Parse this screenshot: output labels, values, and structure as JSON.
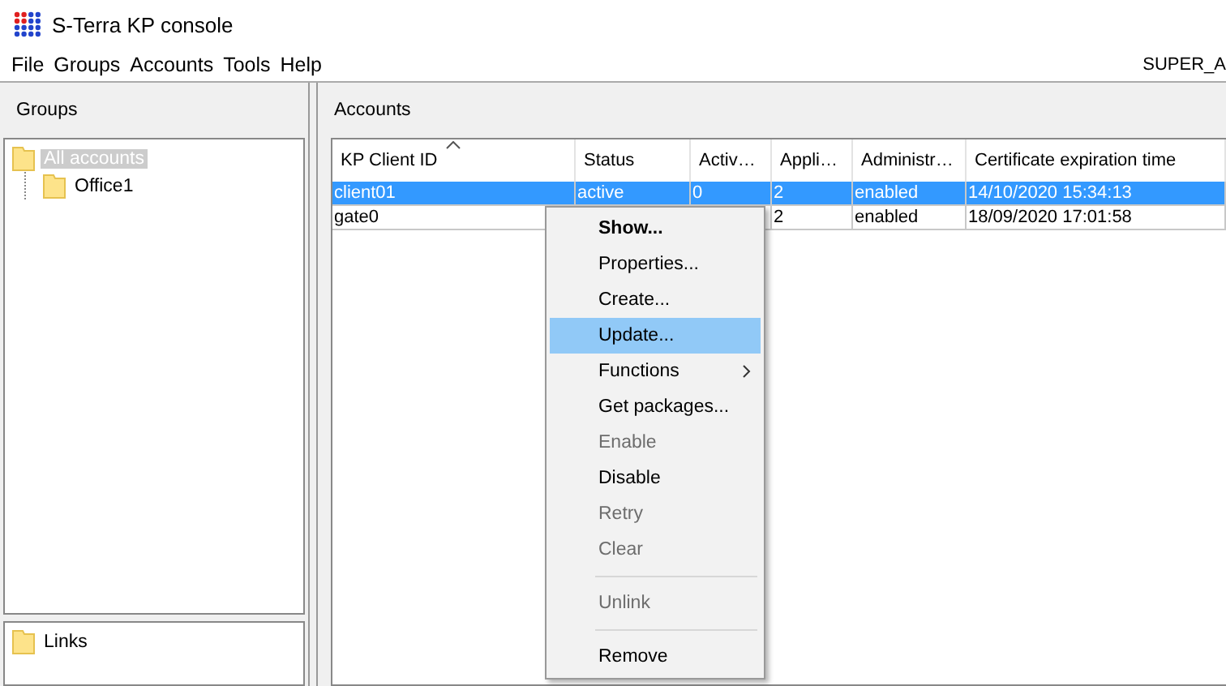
{
  "window": {
    "title": "S-Terra KP console"
  },
  "menu_bar": {
    "items": [
      "File",
      "Groups",
      "Accounts",
      "Tools",
      "Help"
    ],
    "user": "SUPER_A"
  },
  "groups": {
    "title": "Groups",
    "tree": [
      {
        "label": "All accounts",
        "selected": true,
        "children": [
          {
            "label": "Office1",
            "selected": false
          }
        ]
      }
    ],
    "links": [
      {
        "label": "Links"
      }
    ]
  },
  "accounts": {
    "title": "Accounts",
    "columns": [
      {
        "label": "KP Client ID",
        "sorted": true
      },
      {
        "label": "Status",
        "sorted": false
      },
      {
        "label": "Activ…",
        "sorted": false
      },
      {
        "label": "Appli…",
        "sorted": false
      },
      {
        "label": "Administr…",
        "sorted": false
      },
      {
        "label": "Certificate expiration time",
        "sorted": false
      }
    ],
    "rows": [
      {
        "selected": true,
        "cells": [
          "client01",
          "active",
          "0",
          "2",
          "enabled",
          "14/10/2020 15:34:13"
        ]
      },
      {
        "selected": false,
        "cells": [
          "gate0",
          null,
          null,
          "2",
          "enabled",
          "18/09/2020 17:01:58"
        ]
      }
    ]
  },
  "context_menu": [
    {
      "kind": "item",
      "label": "Show...",
      "bold": true,
      "disabled": false,
      "selected": false
    },
    {
      "kind": "item",
      "label": "Properties...",
      "disabled": false,
      "selected": false
    },
    {
      "kind": "item",
      "label": "Create...",
      "disabled": false,
      "selected": false
    },
    {
      "kind": "item",
      "label": "Update...",
      "disabled": false,
      "selected": true
    },
    {
      "kind": "submenu",
      "label": "Functions",
      "disabled": false,
      "selected": false
    },
    {
      "kind": "item",
      "label": "Get packages...",
      "disabled": false,
      "selected": false
    },
    {
      "kind": "item",
      "label": "Enable",
      "disabled": true,
      "selected": false
    },
    {
      "kind": "item",
      "label": "Disable",
      "disabled": false,
      "selected": false
    },
    {
      "kind": "item",
      "label": "Retry",
      "disabled": true,
      "selected": false
    },
    {
      "kind": "item",
      "label": "Clear",
      "disabled": true,
      "selected": false
    },
    {
      "kind": "separator"
    },
    {
      "kind": "item",
      "label": "Unlink",
      "disabled": true,
      "selected": false
    },
    {
      "kind": "separator"
    },
    {
      "kind": "item",
      "label": "Remove",
      "disabled": false,
      "selected": false
    }
  ]
}
